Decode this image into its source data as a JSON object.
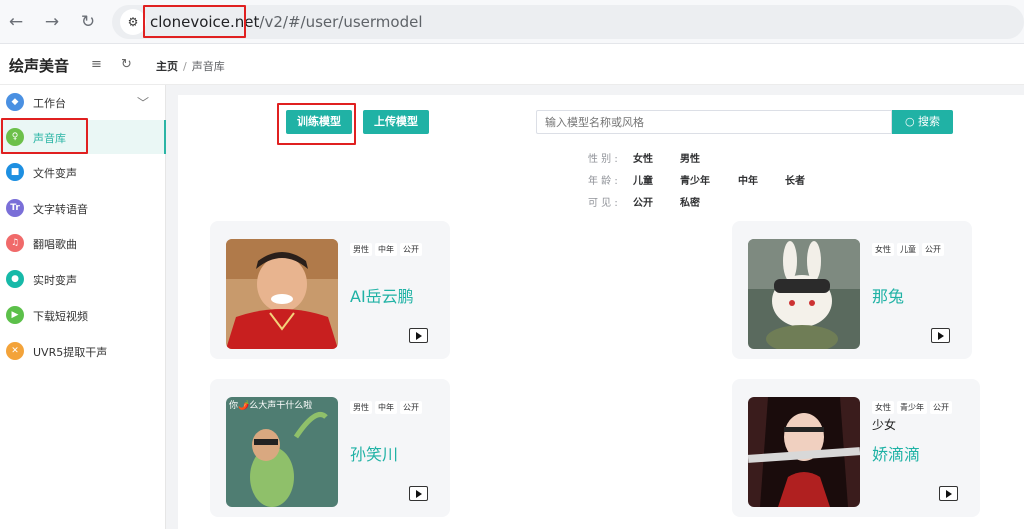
{
  "browser": {
    "back_icon": "←",
    "forward_icon": "→",
    "reload_icon": "↻",
    "site_info_icon": "⚙",
    "url_host": "clonevoice.net",
    "url_path": "/v2/#/user/usermodel"
  },
  "app": {
    "logo": "绘声美音",
    "menu_icon": "≡",
    "refresh_icon": "↻"
  },
  "breadcrumb": {
    "home": "主页",
    "separator": "/",
    "current": "声音库"
  },
  "sidebar": {
    "items": [
      {
        "label": "工作台",
        "icon": "◆",
        "color": "#4a90e2"
      },
      {
        "label": "声音库",
        "icon": "♀",
        "color": "#6cc04a"
      },
      {
        "label": "文件变声",
        "icon": "■",
        "color": "#1d8fe1"
      },
      {
        "label": "文字转语音",
        "icon": "Tr",
        "color": "#7a6fd8"
      },
      {
        "label": "翻唱歌曲",
        "icon": "♫",
        "color": "#f06a6a"
      },
      {
        "label": "实时变声",
        "icon": "●",
        "color": "#17b9a8"
      },
      {
        "label": "下载短视频",
        "icon": "▶",
        "color": "#5cc04a"
      },
      {
        "label": "UVR5提取干声",
        "icon": "✕",
        "color": "#f3a33a"
      }
    ],
    "expand_icon": "﹀"
  },
  "toolbar": {
    "train_label": "训练模型",
    "upload_label": "上传模型",
    "search_placeholder": "输入模型名称或风格",
    "search_label": "搜索",
    "search_icon": "○"
  },
  "filters": {
    "gender": {
      "label": "性 别 :",
      "options": [
        "女性",
        "男性"
      ]
    },
    "age": {
      "label": "年 龄 :",
      "options": [
        "儿童",
        "青少年",
        "中年",
        "长者"
      ]
    },
    "visibility": {
      "label": "可 见 :",
      "options": [
        "公开",
        "私密"
      ]
    }
  },
  "cards": [
    {
      "name": "AI岳云鹏",
      "desc": "",
      "tags": [
        "男性",
        "中年",
        "公开"
      ]
    },
    {
      "name": "那兔",
      "desc": "",
      "tags": [
        "女性",
        "儿童",
        "公开"
      ]
    },
    {
      "name": "孙笑川",
      "desc": "",
      "tags": [
        "男性",
        "中年",
        "公开"
      ],
      "meme_text": "你🌶️么大声干什么啦"
    },
    {
      "name": "娇滴滴",
      "desc": "少女",
      "tags": [
        "女性",
        "青少年",
        "公开"
      ]
    }
  ],
  "colors": {
    "accent": "#20b2a5",
    "highlight_box": "#e02020"
  }
}
